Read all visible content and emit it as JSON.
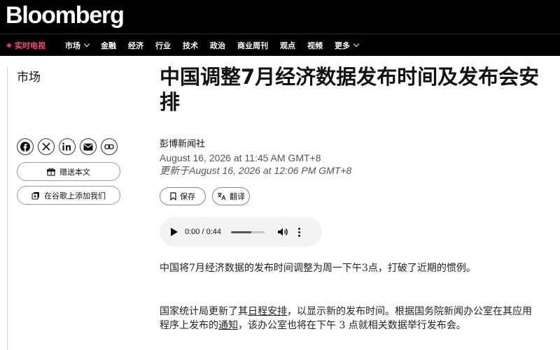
{
  "header": {
    "logo": "Bloomberg"
  },
  "nav": {
    "live": "实时电视",
    "items": [
      "市场",
      "金融",
      "经济",
      "行业",
      "技术",
      "政治",
      "商业周刊",
      "观点",
      "视频",
      "更多"
    ]
  },
  "sidebar": {
    "section": "市场",
    "share_icons": [
      "facebook-icon",
      "x-icon",
      "linkedin-icon",
      "email-icon",
      "link-icon"
    ],
    "gift_label": "赠送本文",
    "google_label": "在谷歌上添加我们"
  },
  "article": {
    "headline": "中国调整7月经济数据发布时间及发布会安排",
    "byline": "彭博新闻社",
    "published": "August 16, 2026 at 11:45 AM GMT+8",
    "updated": "更新于August 16, 2026 at 12:06 PM GMT+8",
    "save_label": "保存",
    "translate_label": "翻译",
    "audio": {
      "time": "0:00 / 0:44",
      "progress": 0.0
    },
    "p1": "中国将7月经济数据的发布时间调整为周一下午3点，打破了近期的惯例。",
    "p2_a": "国家统计局更新了其",
    "p2_link1": "日程安排",
    "p2_b": "，以显示新的发布时间。根据国务院新闻办公室在其应用程序上发布的",
    "p2_link2": "通知",
    "p2_c": "，该办公室也将在下午 3 点就相关数据举行发布会。"
  },
  "colors": {
    "live": "#ff4d6d",
    "header_bg": "#000000"
  }
}
